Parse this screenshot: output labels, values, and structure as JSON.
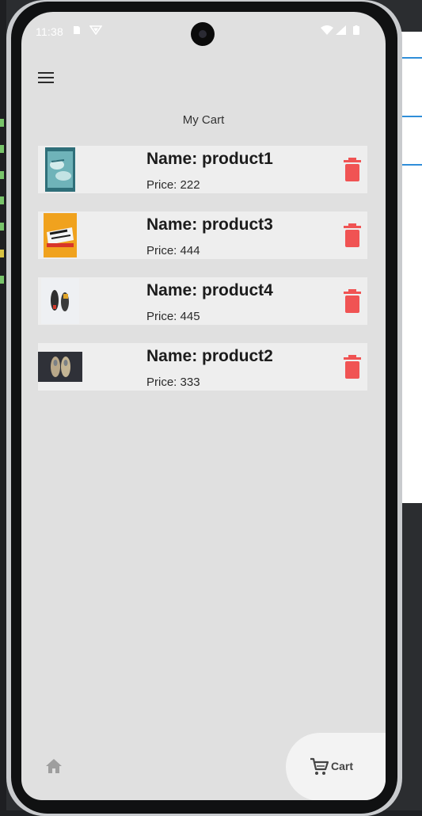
{
  "status_bar": {
    "time": "11:38"
  },
  "app_bar": {
    "menu_icon": "hamburger-menu-icon"
  },
  "page": {
    "title": "My Cart"
  },
  "cart": {
    "items": [
      {
        "name": "Name: product1",
        "price": "Price: 222",
        "thumb_colors": [
          "#3b7f8a",
          "#7ec0c4"
        ]
      },
      {
        "name": "Name: product3",
        "price": "Price: 444",
        "thumb_colors": [
          "#f0a21e",
          "#d8342a"
        ]
      },
      {
        "name": "Name: product4",
        "price": "Price: 445",
        "thumb_colors": [
          "#eef0f3",
          "#3a3a3a"
        ]
      },
      {
        "name": "Name: product2",
        "price": "Price: 333",
        "thumb_colors": [
          "#2f3138",
          "#b9a889"
        ]
      }
    ],
    "delete_icon": "trash-icon",
    "delete_color": "#f05353"
  },
  "bottom_nav": {
    "home_icon": "home-icon",
    "cart_icon": "shopping-cart-icon",
    "cart_label": "Cart"
  }
}
